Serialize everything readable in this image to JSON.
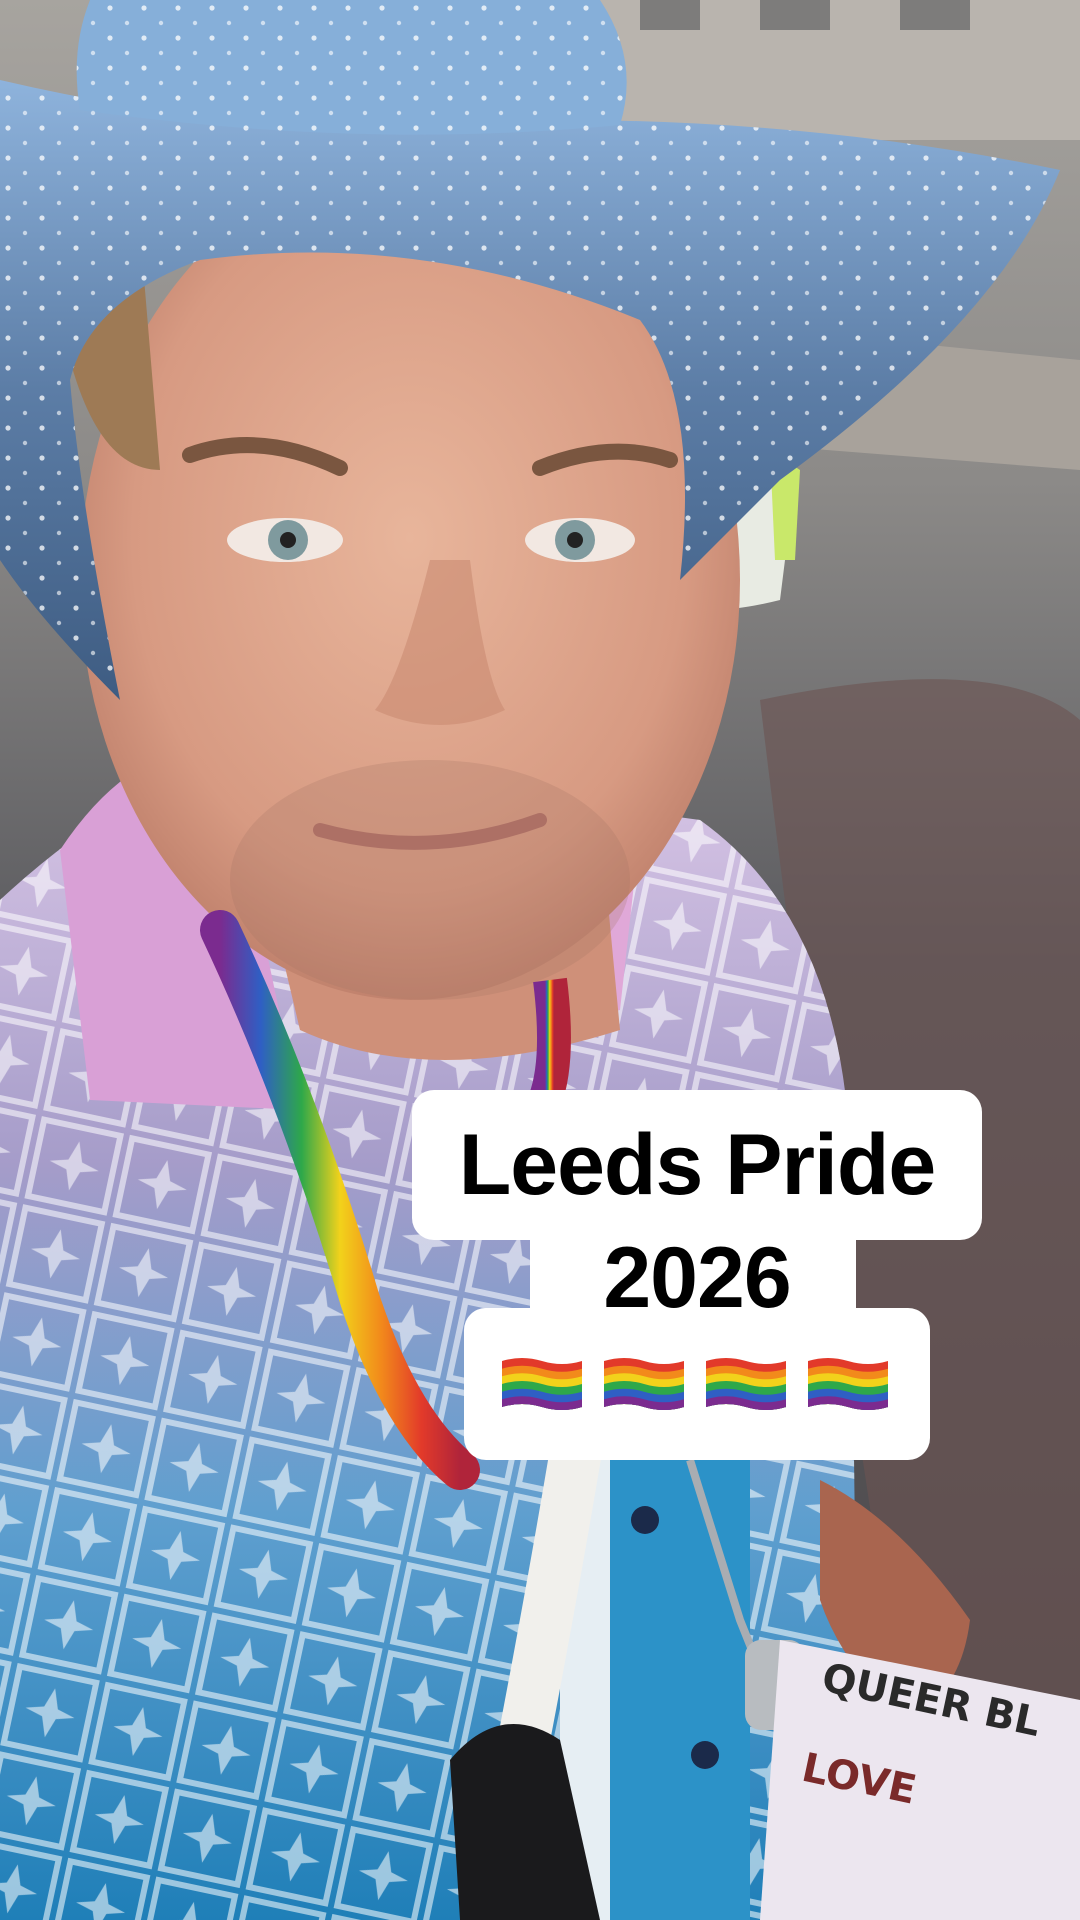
{
  "caption": {
    "line1": "Leeds Pride",
    "line2": "2026",
    "flags": [
      "rainbow-flag-emoji",
      "rainbow-flag-emoji",
      "rainbow-flag-emoji",
      "rainbow-flag-emoji"
    ]
  },
  "sign": {
    "text": "QUEER BL..."
  },
  "colors": {
    "caption_bg": "#ffffff",
    "caption_text": "#000000",
    "hat": "#4f6f95",
    "shirt_top": "#c9b2dd",
    "shirt_bottom": "#2e8fc2",
    "collar": "#d79ad3"
  }
}
